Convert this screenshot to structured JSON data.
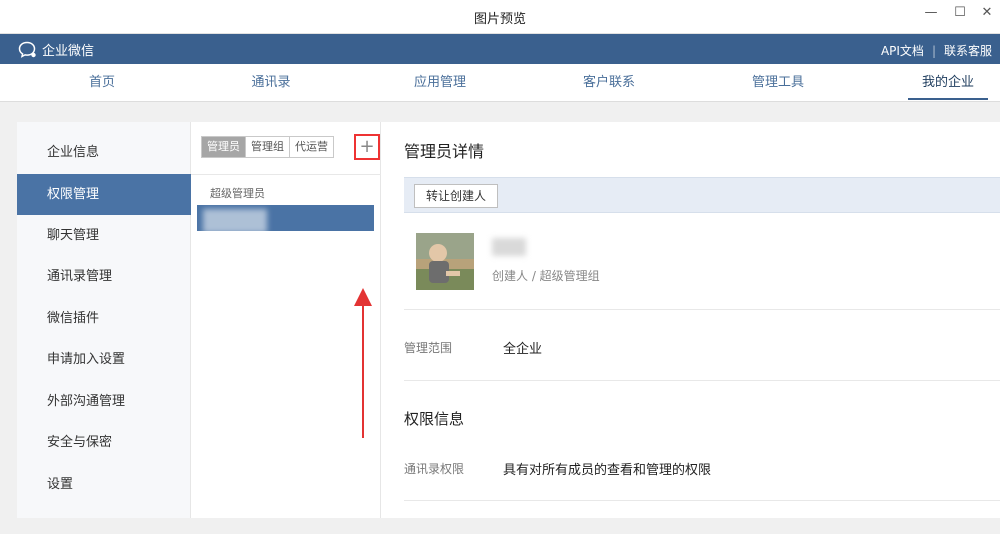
{
  "window": {
    "title": "图片预览",
    "minimize": "—",
    "maximize": "☐",
    "close": "✕"
  },
  "brand": {
    "name": "企业微信",
    "api_docs": "API文档",
    "separator": "|",
    "support": "联系客服"
  },
  "nav": [
    "首页",
    "通讯录",
    "应用管理",
    "客户联系",
    "管理工具",
    "我的企业"
  ],
  "sidebar": [
    "企业信息",
    "权限管理",
    "聊天管理",
    "通讯录管理",
    "微信插件",
    "申请加入设置",
    "外部沟通管理",
    "安全与保密",
    "设置"
  ],
  "admin_panel": {
    "tabs": [
      "管理员",
      "管理组",
      "代运营"
    ],
    "add_symbol": "+",
    "group_label": "超级管理员"
  },
  "detail": {
    "title": "管理员详情",
    "transfer_button": "转让创建人",
    "role": "创建人 / 超级管理组",
    "scope_label": "管理范围",
    "scope_value": "全企业",
    "perm_section": "权限信息",
    "contacts_perm_label": "通讯录权限",
    "contacts_perm_value": "具有对所有成员的查看和管理的权限"
  },
  "colors": {
    "brand_bar": "#3a608e",
    "nav_text": "#4a6f9a",
    "active_item": "#4a73a5",
    "highlight": "#e33333"
  }
}
